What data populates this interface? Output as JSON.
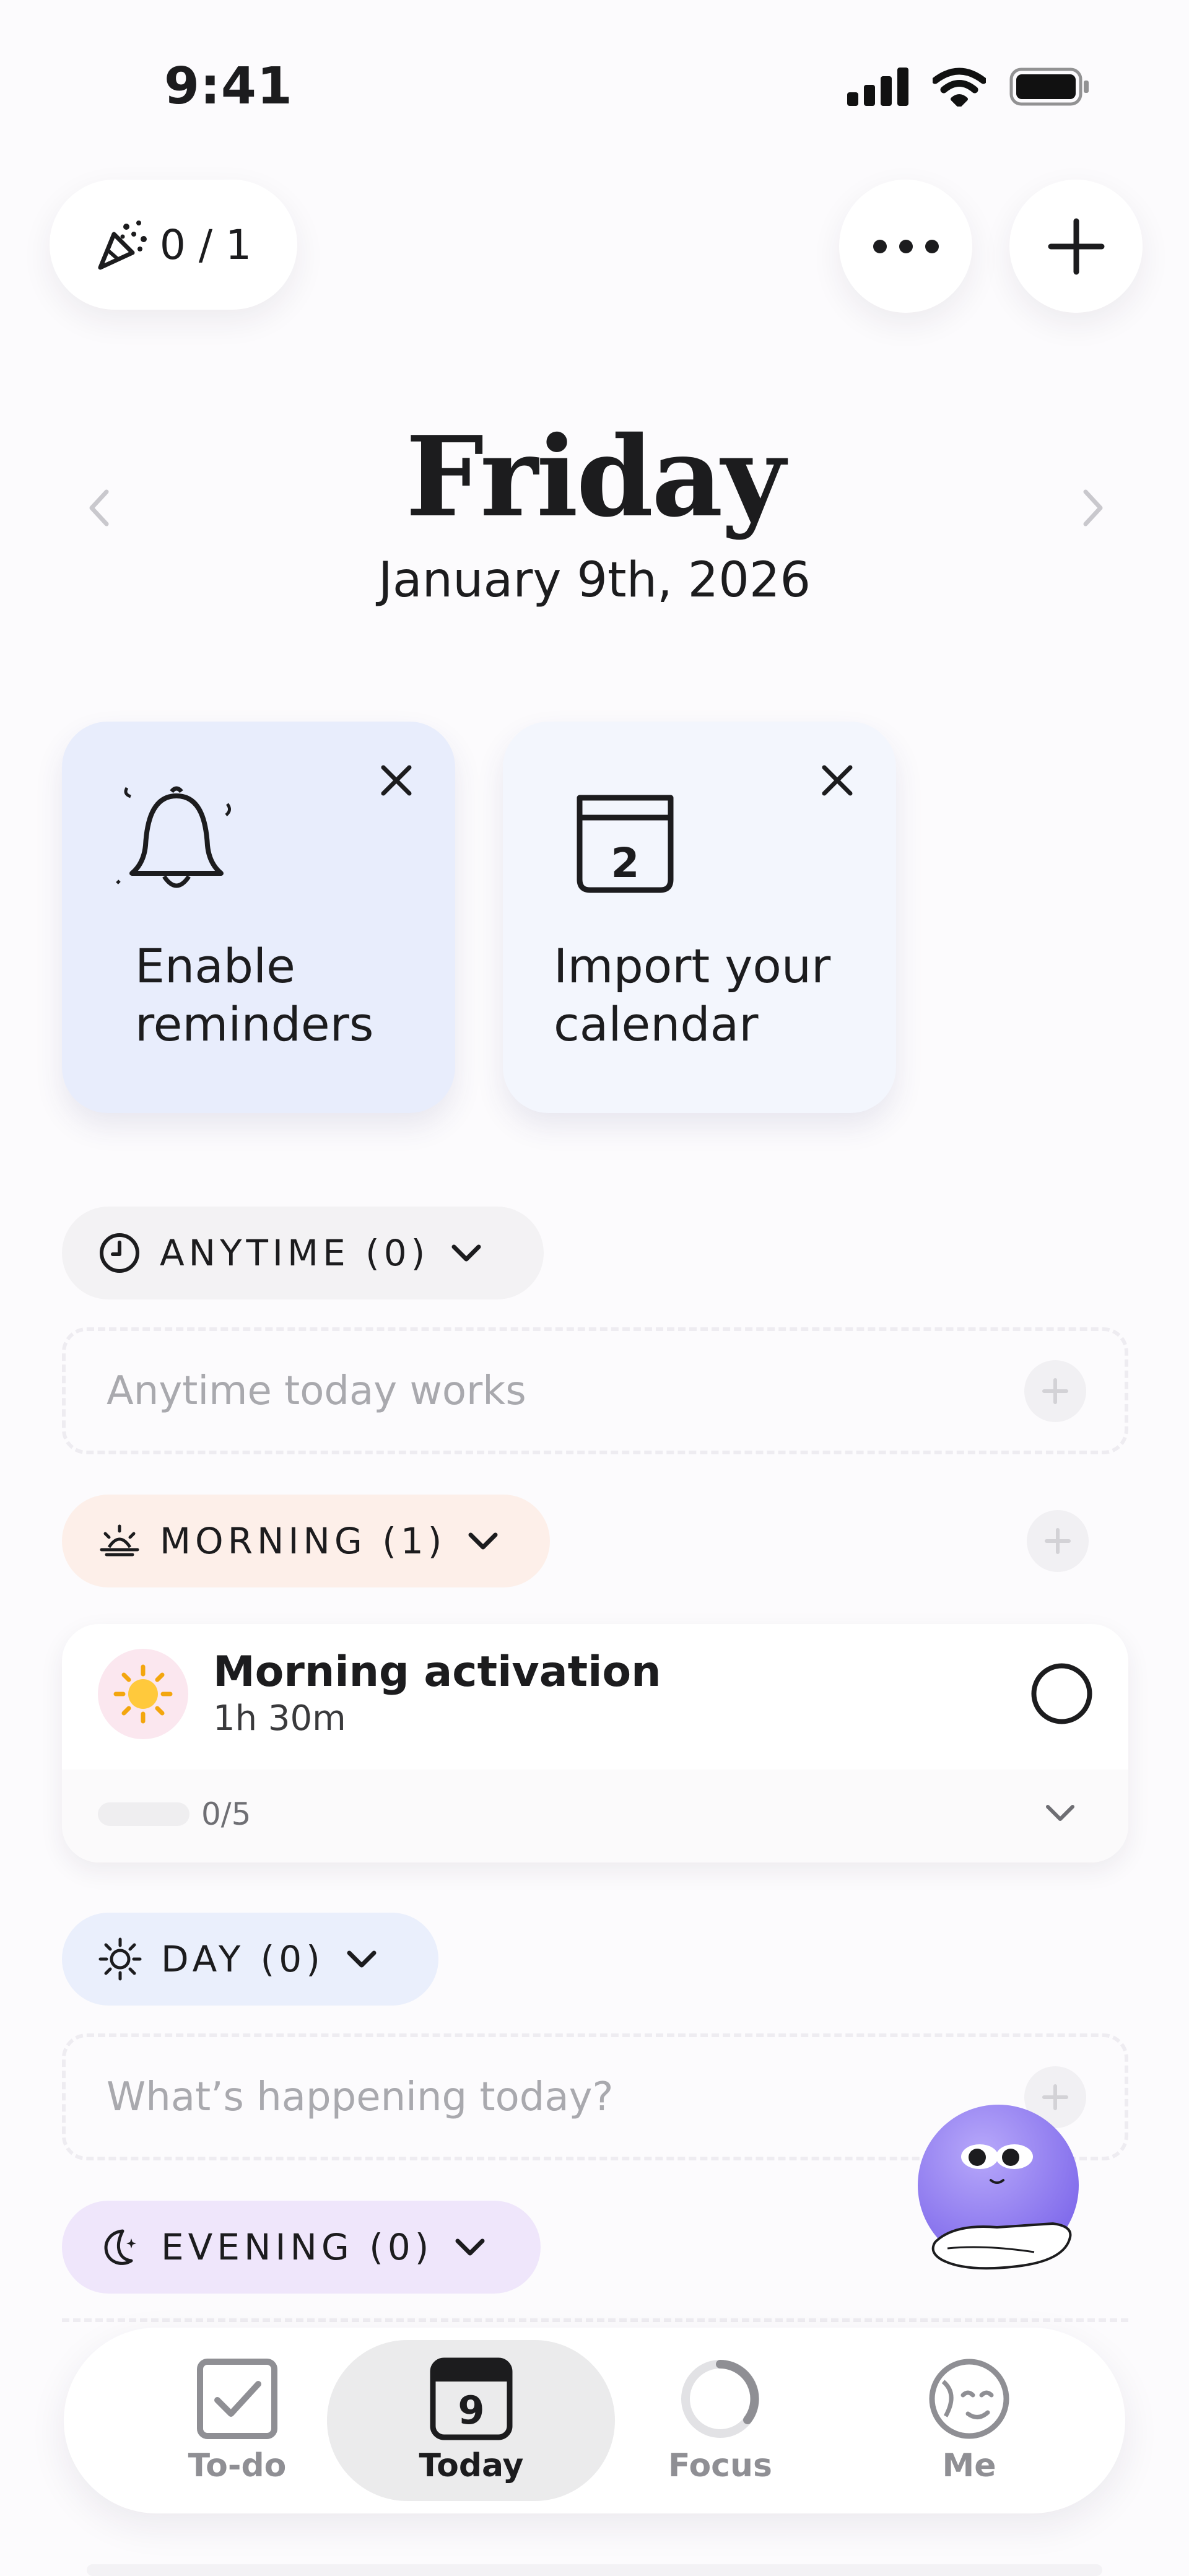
{
  "status_bar": {
    "time": "9:41"
  },
  "header": {
    "counter": "0 / 1",
    "more_icon": "ellipsis-icon",
    "add_icon": "plus-icon"
  },
  "date": {
    "weekday": "Friday",
    "full_date": "January 9th, 2026"
  },
  "cards": [
    {
      "label_line1": "Enable",
      "label_line2": "reminders",
      "icon": "bell-icon",
      "bg": "#E8EDFC"
    },
    {
      "label_line1": "Import your",
      "label_line2": "calendar",
      "icon": "calendar-icon",
      "calendar_day": "2",
      "bg": "#F3F6FD"
    }
  ],
  "sections": {
    "anytime": {
      "label": "ANYTIME (0)",
      "placeholder": "Anytime today works",
      "bg": "#F3F2F4"
    },
    "morning": {
      "label": "MORNING (1)",
      "bg": "#FDEFE9"
    },
    "day": {
      "label": "DAY (0)",
      "placeholder": "What’s happening today?",
      "bg": "#EAEFFC"
    },
    "evening": {
      "label": "EVENING (0)",
      "bg": "#EFE6FB"
    }
  },
  "task": {
    "title": "Morning activation",
    "duration": "1h 30m",
    "progress_text": "0/5",
    "progress": 0,
    "emoji": "☀️"
  },
  "tabs": [
    {
      "label": "To-do",
      "icon": "checkbox-icon"
    },
    {
      "label": "Today",
      "icon": "calendar-icon",
      "day": "9",
      "active": true
    },
    {
      "label": "Focus",
      "icon": "focus-ring-icon"
    },
    {
      "label": "Me",
      "icon": "face-icon"
    }
  ],
  "colors": {
    "accent_purple": "#8F7CF0",
    "text": "#1C1C1E",
    "muted": "#A9A9AE"
  }
}
